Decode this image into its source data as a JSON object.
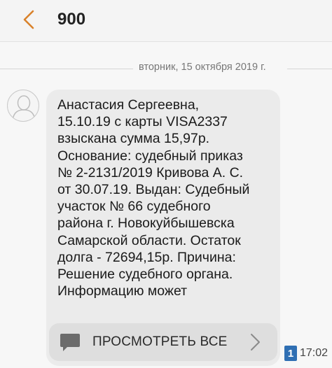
{
  "header": {
    "title": "900",
    "back_icon": "chevron-left-icon",
    "accent_color": "#d9822b"
  },
  "conversation": {
    "date_separator": "вторник, 15 октября 2019 г.",
    "message": {
      "text": "Анастасия Сергеевна,\n15.10.19 с карты VISA2337\nвзыскана сумма 15,97р.\nОснование: судебный приказ\n№ 2-2131/2019 Кривова А. С.\nот 30.07.19. Выдан: Судебный\nучасток № 66 судебного\nрайона г. Новокуйбышевска\nСамарской области. Остаток\nдолга - 72694,15р. Причина:\nРешение судебного органа.\nИнформацию может",
      "view_all_label": "ПРОСМОТРЕТЬ ВСЕ",
      "sim_slot": "1",
      "time": "17:02"
    }
  },
  "colors": {
    "bubble": "#ebebeb",
    "sim_badge": "#2f6fb3"
  }
}
